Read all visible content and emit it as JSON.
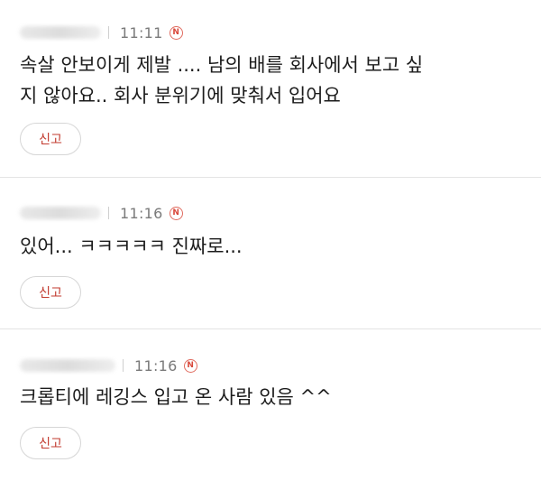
{
  "comments": [
    {
      "time": "11:11",
      "new_badge": "N",
      "body": "속살 안보이게 제발 .... 남의 배를 회사에서 보고 싶\n지 않아요.. 회사 분위기에 맞춰서 입어요",
      "report_label": "신고"
    },
    {
      "time": "11:16",
      "new_badge": "N",
      "body": "있어... ㅋㅋㅋㅋㅋ 진짜로...",
      "report_label": "신고"
    },
    {
      "time": "11:16",
      "new_badge": "N",
      "body": "크롭티에 레깅스 입고 온 사람 있음 ^^",
      "report_label": "신고"
    }
  ],
  "colors": {
    "accent": "#c23a2e",
    "badge": "#d9483b",
    "time": "#7a7a7a",
    "divider": "#e4e4e4"
  }
}
